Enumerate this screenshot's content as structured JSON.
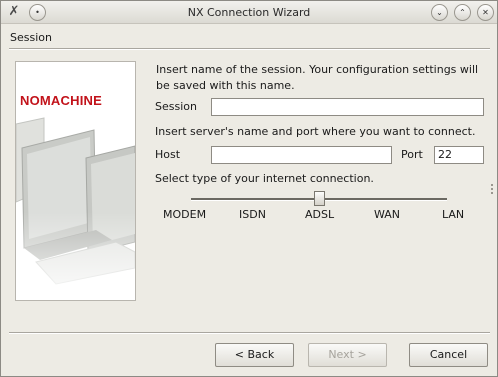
{
  "window": {
    "title": "NX Connection Wizard"
  },
  "header": {
    "label": "Session"
  },
  "logo": {
    "text": "NOMACHINE"
  },
  "form": {
    "intro": "Insert name of the session. Your configuration settings will be saved with this name.",
    "session_label": "Session",
    "session_value": "",
    "server_intro": "Insert server's name and port where you want to connect.",
    "host_label": "Host",
    "host_value": "",
    "port_label": "Port",
    "port_value": "22",
    "connection_intro": "Select type of your internet connection.",
    "connection_options": [
      "MODEM",
      "ISDN",
      "ADSL",
      "WAN",
      "LAN"
    ],
    "connection_selected": "ADSL"
  },
  "buttons": {
    "back": "< Back",
    "next": "Next >",
    "cancel": "Cancel"
  },
  "icons": {
    "app": "nx-app-icon",
    "menu": "window-menu-icon",
    "minimize": "minimize-icon",
    "maximize": "maximize-icon",
    "close": "close-icon"
  },
  "colors": {
    "logo": "#c2121a",
    "window_bg": "#edebe4"
  }
}
